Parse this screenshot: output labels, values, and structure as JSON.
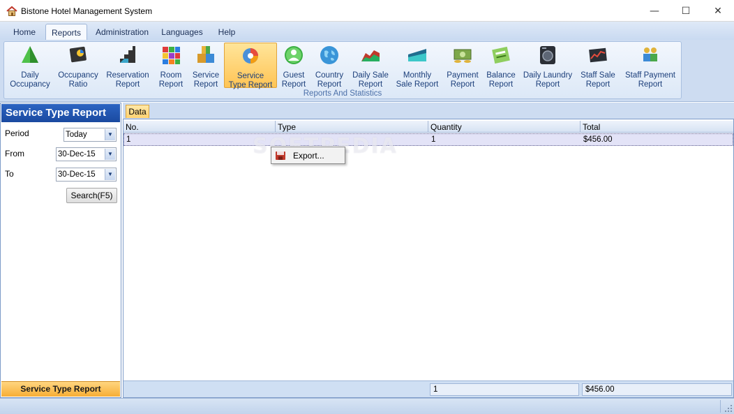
{
  "window": {
    "title": "Bistone Hotel Management System",
    "minimize": "—",
    "maximize": "☐",
    "close": "✕"
  },
  "menu": {
    "tabs": [
      {
        "label": "Home"
      },
      {
        "label": "Reports"
      },
      {
        "label": "Administration"
      },
      {
        "label": "Languages"
      },
      {
        "label": "Help"
      }
    ],
    "active_tab": "Reports"
  },
  "ribbon": {
    "group_label": "Reports And Statistics",
    "buttons": [
      {
        "line1": "Daily",
        "line2": "Occupancy",
        "icon": "pyramid-icon"
      },
      {
        "line1": "Occupancy",
        "line2": "Ratio",
        "icon": "pie-chart-icon"
      },
      {
        "line1": "Reservation",
        "line2": "Report",
        "icon": "stairs-icon"
      },
      {
        "line1": "Room",
        "line2": "Report",
        "icon": "cubes-icon"
      },
      {
        "line1": "Service",
        "line2": "Report",
        "icon": "boxes-icon"
      },
      {
        "line1": "Service",
        "line2": "Type Report",
        "icon": "service-type-icon"
      },
      {
        "line1": "Guest",
        "line2": "Report",
        "icon": "guest-icon"
      },
      {
        "line1": "Country",
        "line2": "Report",
        "icon": "globe-icon"
      },
      {
        "line1": "Daily Sale",
        "line2": "Report",
        "icon": "area-chart-icon"
      },
      {
        "line1": "Monthly",
        "line2": "Sale Report",
        "icon": "monthly-chart-icon"
      },
      {
        "line1": "Payment",
        "line2": "Report",
        "icon": "money-icon"
      },
      {
        "line1": "Balance",
        "line2": "Report",
        "icon": "calculator-icon"
      },
      {
        "line1": "Daily Laundry",
        "line2": "Report",
        "icon": "washer-icon"
      },
      {
        "line1": "Staff Sale",
        "line2": "Report",
        "icon": "stock-chart-icon"
      },
      {
        "line1": "Staff Payment",
        "line2": "Report",
        "icon": "staff-icon"
      }
    ]
  },
  "left_panel": {
    "header": "Service Type Report",
    "period_label": "Period",
    "period_value": "Today",
    "from_label": "From",
    "from_value": "30-Dec-15",
    "to_label": "To",
    "to_value": "30-Dec-15",
    "search_button": "Search(F5)",
    "footer": "Service Type Report"
  },
  "data_tab": {
    "label": "Data"
  },
  "grid": {
    "columns": [
      "No.",
      "Type",
      "Quantity",
      "Total"
    ],
    "rows": [
      {
        "no": "1",
        "type": "",
        "quantity": "1",
        "total": "$456.00"
      }
    ],
    "footer": {
      "quantity": "1",
      "total": "$456.00"
    }
  },
  "context_menu": {
    "items": [
      {
        "label": "Export..."
      }
    ]
  },
  "watermark": "SOFTPEDIA",
  "colors": {
    "accent": "#1a4aa0",
    "highlight": "#ffc455",
    "ribbon_bg": "#cddcf1"
  }
}
